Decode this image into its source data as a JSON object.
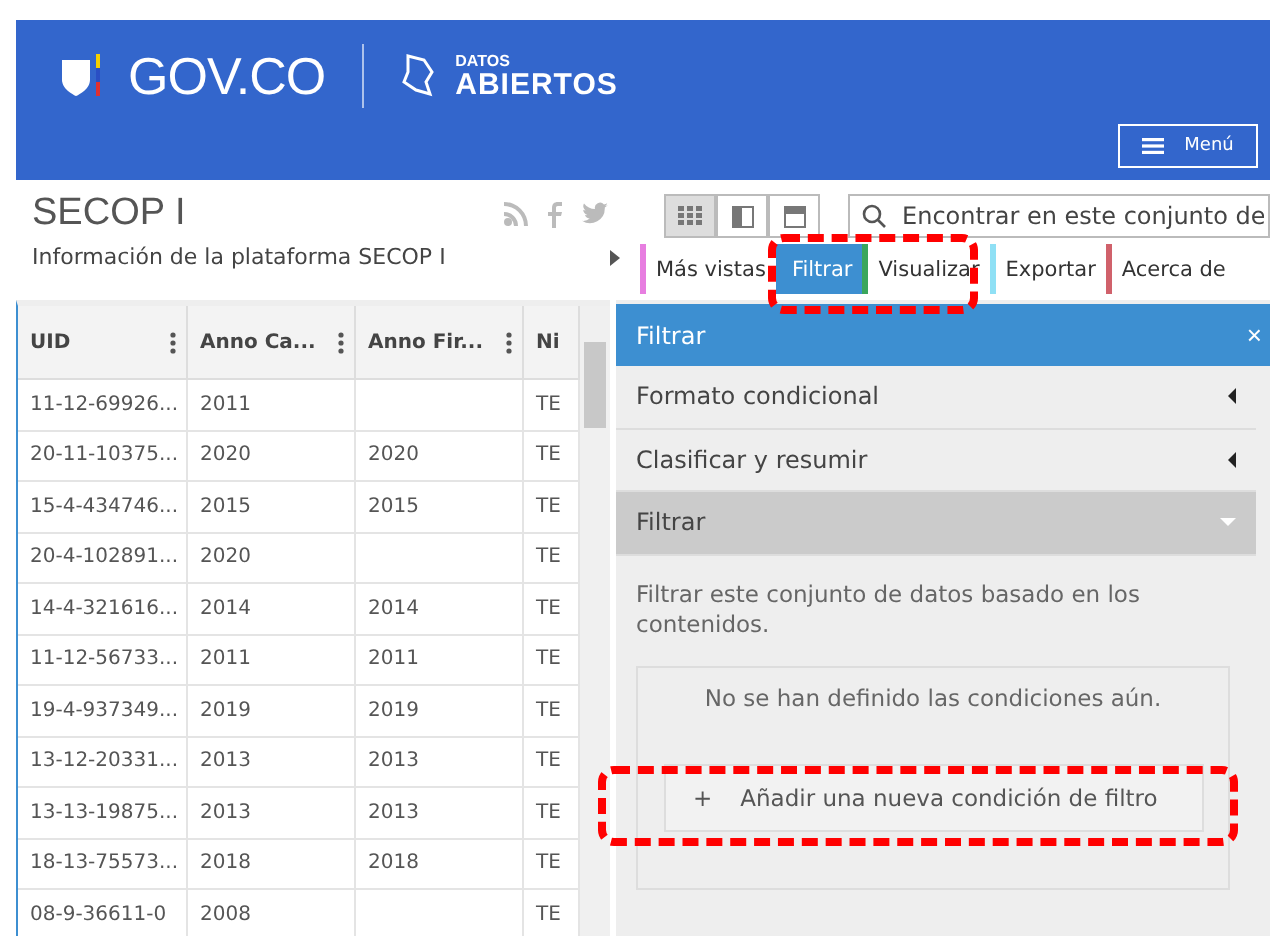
{
  "header": {
    "logo_text": "GOV.CO",
    "brand_top": "DATOS",
    "brand_bottom": "ABIERTOS",
    "menu_label": "Menú"
  },
  "dataset": {
    "title": "SECOP I",
    "subtitle": "Información de la plataforma SECOP I"
  },
  "view_buttons": [
    {
      "kind": "grid",
      "selected": true
    },
    {
      "kind": "split",
      "selected": false
    },
    {
      "kind": "page",
      "selected": false
    }
  ],
  "search": {
    "placeholder": "Encontrar en este conjunto de"
  },
  "tabs": [
    {
      "label": "Más vistas",
      "selected": false,
      "color": "#e77ee0"
    },
    {
      "label": "Filtrar",
      "selected": true,
      "color": "#3d8fd1"
    },
    {
      "label": "Visualizar",
      "selected": false,
      "color": "#3aa65c"
    },
    {
      "label": "Exportar",
      "selected": false,
      "color": "#8fe0f5"
    },
    {
      "label": "Acerca de",
      "selected": false,
      "color": "#d0616b"
    }
  ],
  "table": {
    "columns": [
      "UID",
      "Anno Ca...",
      "Anno Fir...",
      "Ni"
    ],
    "rows": [
      [
        "11-12-69926...",
        "2011",
        "",
        "TE"
      ],
      [
        "20-11-10375...",
        "2020",
        "2020",
        "TE"
      ],
      [
        "15-4-434746...",
        "2015",
        "2015",
        "TE"
      ],
      [
        "20-4-102891...",
        "2020",
        "",
        "TE"
      ],
      [
        "14-4-321616...",
        "2014",
        "2014",
        "TE"
      ],
      [
        "11-12-56733...",
        "2011",
        "2011",
        "TE"
      ],
      [
        "19-4-937349...",
        "2019",
        "2019",
        "TE"
      ],
      [
        "13-12-20331...",
        "2013",
        "2013",
        "TE"
      ],
      [
        "13-13-19875...",
        "2013",
        "2013",
        "TE"
      ],
      [
        "18-13-75573...",
        "2018",
        "2018",
        "TE"
      ],
      [
        "08-9-36611-0",
        "2008",
        "",
        "TE"
      ]
    ]
  },
  "panel": {
    "title": "Filtrar",
    "close": "×",
    "sections": [
      {
        "label": "Formato condicional",
        "expanded": false
      },
      {
        "label": "Clasificar y resumir",
        "expanded": false
      },
      {
        "label": "Filtrar",
        "expanded": true
      }
    ],
    "description": "Filtrar este conjunto de datos basado en los contenidos.",
    "empty_message": "No se han definido las condiciones aún.",
    "add_button": {
      "icon": "+",
      "label": "Añadir una nueva condición de filtro"
    }
  },
  "highlights": {
    "tabs": true,
    "add_button": true
  }
}
